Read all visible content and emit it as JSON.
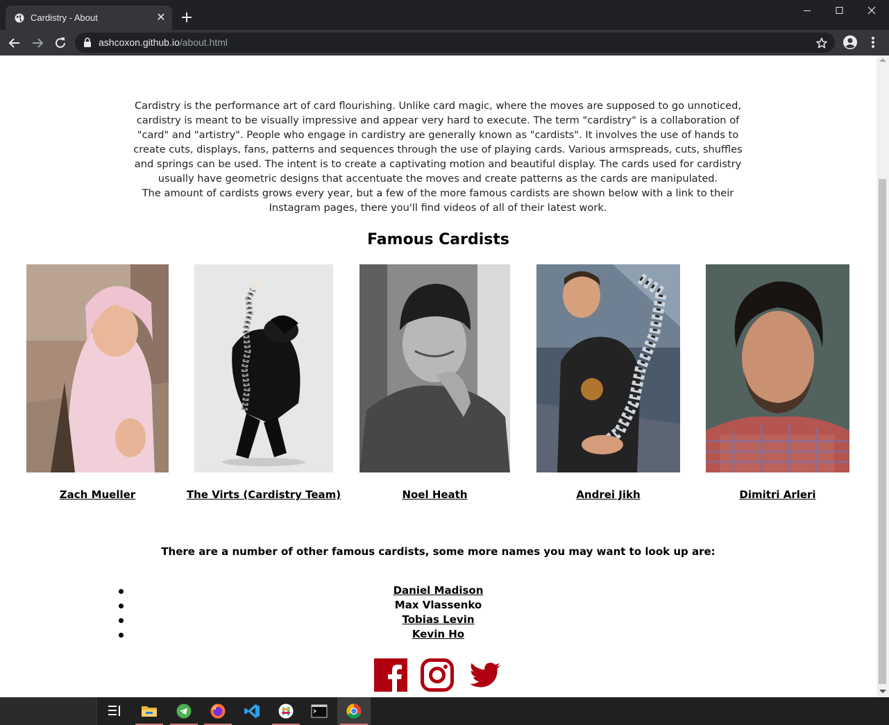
{
  "browser": {
    "tab_title": "Cardistry - About",
    "url_host": "ashcoxon.github.io",
    "url_path": "/about.html"
  },
  "page": {
    "intro_p1": "Cardistry is the performance art of card flourishing. Unlike card magic, where the moves are supposed to go unnoticed, cardistry is meant to be visually impressive and appear very hard to execute. The term \"cardistry\" is a collaboration of \"card\" and \"artistry\". People who engage in cardistry are generally known as \"cardists\". It involves the use of hands to create cuts, displays, fans, patterns and sequences through the use of playing cards. Various armspreads, cuts, shuffles and springs can be used. The intent is to create a captivating motion and beautiful display. The cards used for cardistry usually have geometric designs that accentuate the moves and create patterns as the cards are manipulated.",
    "intro_p2": "The amount of cardists grows every year, but a few of the more famous cardists are shown below with a link to their Instagram pages, there you'll find videos of all of their latest work.",
    "section_title": "Famous Cardists",
    "cardists": [
      {
        "name": "Zach Mueller"
      },
      {
        "name": "The Virts (Cardistry Team)"
      },
      {
        "name": "Noel Heath"
      },
      {
        "name": "Andrei Jikh"
      },
      {
        "name": "Dimitri Arleri"
      }
    ],
    "more_heading": "There are a number of other famous cardists, some more names you may want to look up are:",
    "more_names": [
      {
        "name": "Daniel Madison",
        "link": true
      },
      {
        "name": "Max Vlassenko",
        "link": false
      },
      {
        "name": "Tobias Levin",
        "link": true
      },
      {
        "name": "Kevin Ho",
        "link": true
      }
    ],
    "social_icons": [
      "facebook-icon",
      "instagram-icon",
      "twitter-icon"
    ],
    "accent_color": "#b00010"
  },
  "taskbar": {
    "apps": [
      "task-view-icon",
      "file-explorer-icon",
      "telegram-icon",
      "firefox-icon",
      "vscode-icon",
      "slack-icon",
      "terminal-icon",
      "chrome-icon"
    ]
  }
}
